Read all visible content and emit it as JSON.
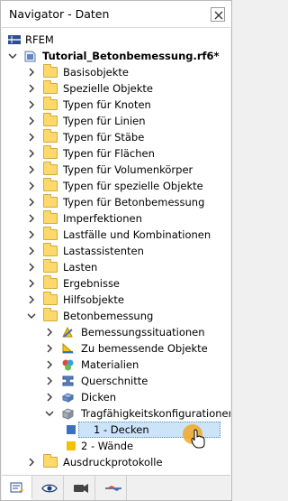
{
  "window": {
    "title": "Navigator - Daten"
  },
  "tree": {
    "root": "RFEM",
    "model": "Tutorial_Betonbemessung.rf6*",
    "folders": [
      "Basisobjekte",
      "Spezielle Objekte",
      "Typen für Knoten",
      "Typen für Linien",
      "Typen für Stäbe",
      "Typen für Flächen",
      "Typen für Volumenkörper",
      "Typen für spezielle Objekte",
      "Typen für Betonbemessung",
      "Imperfektionen",
      "Lastfälle und Kombinationen",
      "Lastassistenten",
      "Lasten",
      "Ergebnisse",
      "Hilfsobjekte"
    ],
    "betonbemessung": {
      "label": "Betonbemessung",
      "children": [
        "Bemessungssituationen",
        "Zu bemessende Objekte",
        "Materialien",
        "Querschnitte",
        "Dicken",
        "Tragfähigkeitskonfigurationen"
      ],
      "configs": [
        "1 - Decken",
        "2 - Wände"
      ]
    },
    "last_folder": "Ausdruckprotokolle"
  },
  "tabs": [
    "data-tab",
    "view-tab",
    "camera-tab",
    "results-tab"
  ],
  "colors": {
    "selection": "#cce4f7",
    "folder": "#fcd96a",
    "accent": "#f2a825"
  }
}
